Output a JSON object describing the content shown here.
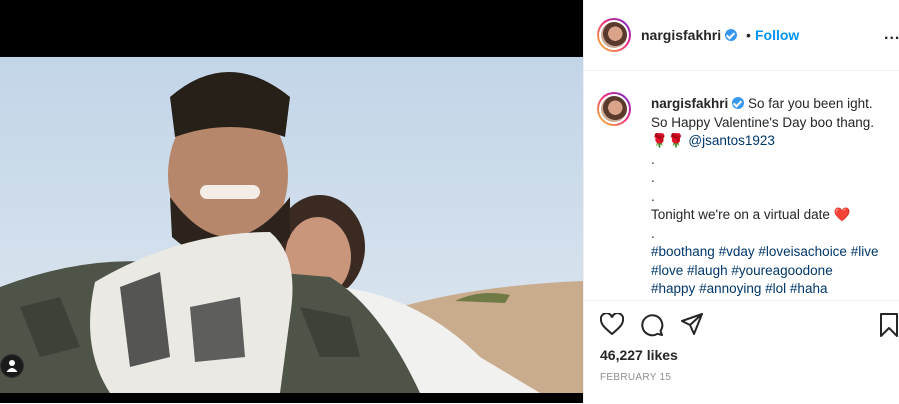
{
  "post": {
    "username": "nargisfakhri",
    "follow_label": "Follow",
    "separator": "•",
    "more_label": "...",
    "caption_lines": [
      "So far you been ight.",
      "So Happy Valentine's Day boo thang.",
      "",
      ".",
      ".",
      ".",
      "Tonight we're on a virtual date ❤️",
      ".",
      "",
      "",
      ""
    ],
    "caption_emoji_prefix": "🌹🌹 ",
    "caption_mention": "@jsantos1923",
    "hashtags_line1": [
      "#boothang",
      "#vday",
      "#loveisachoice",
      "#live"
    ],
    "hashtags_line2": [
      "#love",
      "#laugh",
      "#youreagoodone"
    ],
    "hashtags_line3": [
      "#happy",
      "#annoying",
      "#lol",
      "#haha"
    ],
    "likes": "46,227 likes",
    "date": "FEBRUARY 15"
  },
  "icons": [
    "verified-badge-icon",
    "heart-icon",
    "comment-icon",
    "share-icon",
    "bookmark-icon",
    "user-tag-icon",
    "more-options-icon"
  ],
  "colors": {
    "accent": "#0095f6",
    "hashtag": "#00376b",
    "verified": "#3897f0",
    "muted": "#8e8e8e"
  }
}
